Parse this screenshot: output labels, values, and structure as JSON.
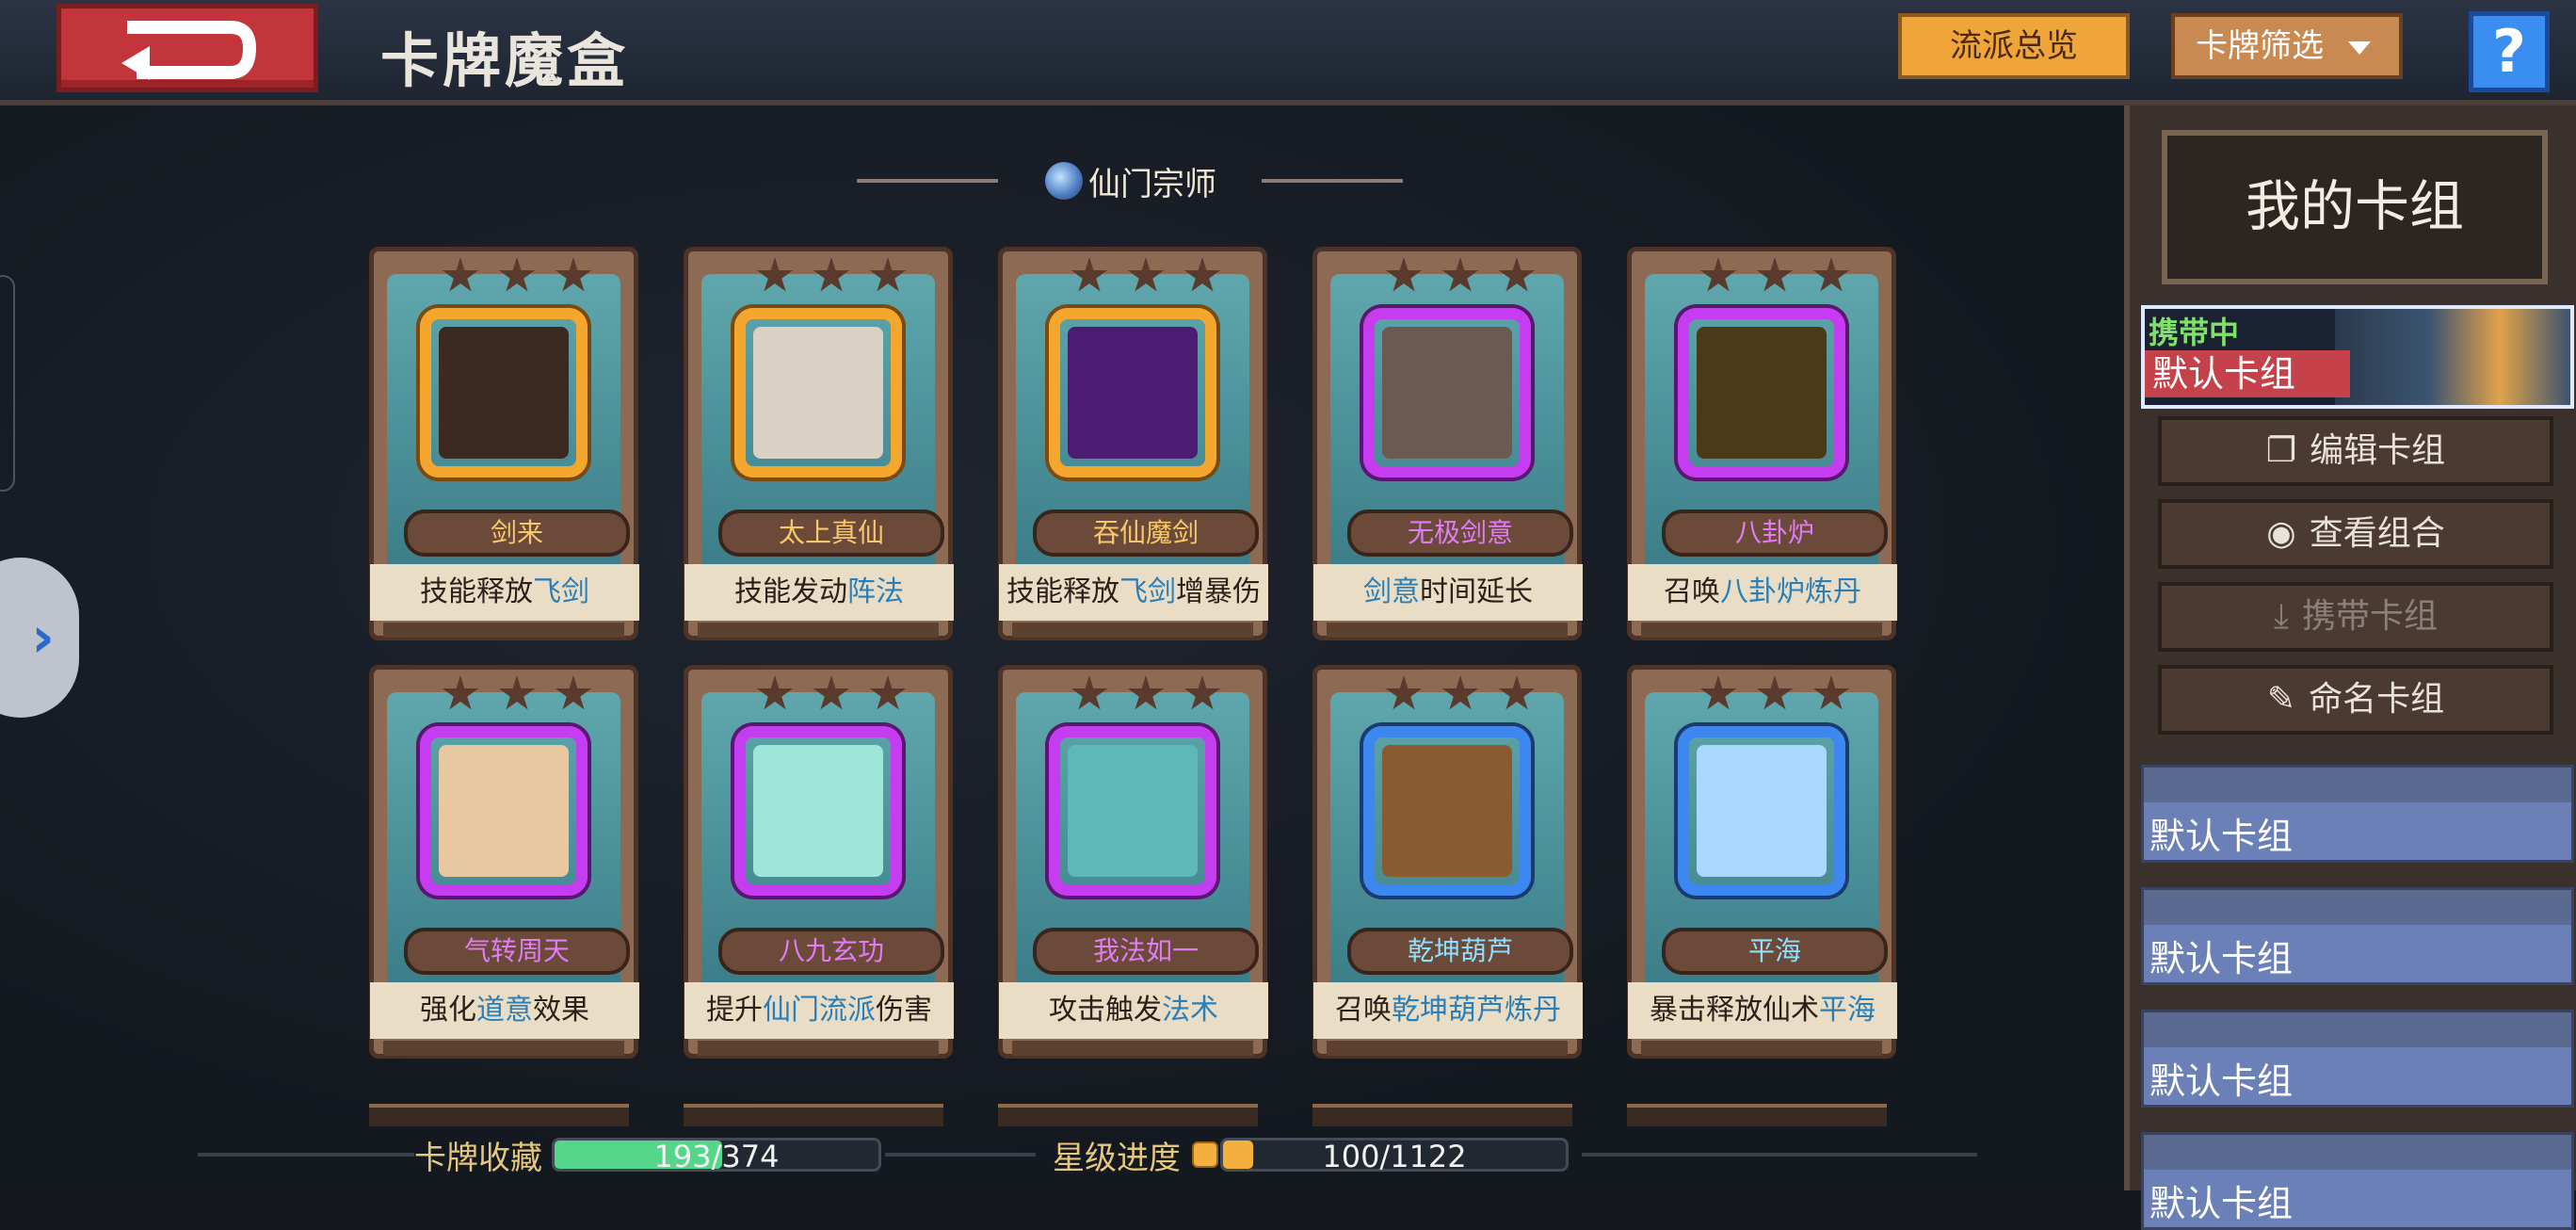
{
  "header": {
    "title": "卡牌魔盒",
    "overview_label": "流派总览",
    "filter_label": "卡牌筛选",
    "help_label": "?"
  },
  "section": {
    "title": "仙门宗师"
  },
  "cards": [
    {
      "name": "剑来",
      "desc_plain": "技能释放",
      "desc_hl": "飞剑",
      "desc_tail": "",
      "rarity": "gold",
      "art": "#3a2a20"
    },
    {
      "name": "太上真仙",
      "desc_plain": "技能发动",
      "desc_hl": "阵法",
      "desc_tail": "",
      "rarity": "gold",
      "art": "#d9d2c4"
    },
    {
      "name": "吞仙魔剑",
      "desc_plain": "技能释放",
      "desc_hl": "飞剑",
      "desc_tail": "增暴伤",
      "rarity": "gold",
      "art": "#4a1c72"
    },
    {
      "name": "无极剑意",
      "desc_plain": "",
      "desc_hl": "剑意",
      "desc_tail": "时间延长",
      "rarity": "purple",
      "art": "#6a5a50"
    },
    {
      "name": "八卦炉",
      "desc_plain": "召唤",
      "desc_hl": "八卦炉炼丹",
      "desc_tail": "",
      "rarity": "purple",
      "art": "#4a3a1a"
    },
    {
      "name": "气转周天",
      "desc_plain": "强化",
      "desc_hl": "道意",
      "desc_tail": "效果",
      "rarity": "purple",
      "art": "#e8c8a0"
    },
    {
      "name": "八九玄功",
      "desc_plain": "提升",
      "desc_hl": "仙门流派",
      "desc_tail": "伤害",
      "rarity": "purple",
      "art": "#9fe6d8"
    },
    {
      "name": "我法如一",
      "desc_plain": "攻击触发",
      "desc_hl": "法术",
      "desc_tail": "",
      "rarity": "purple",
      "art": "#5fb8b8"
    },
    {
      "name": "乾坤葫芦",
      "desc_plain": "召唤",
      "desc_hl": "乾坤葫芦炼丹",
      "desc_tail": "",
      "rarity": "blue",
      "art": "#8a5a30"
    },
    {
      "name": "平海",
      "desc_plain": "暴击释放仙术",
      "desc_hl": "平海",
      "desc_tail": "",
      "rarity": "blue",
      "art": "#a8d8ff"
    }
  ],
  "footer": {
    "collection_label": "卡牌收藏",
    "collection_value": "193/374",
    "collection_fraction": 0.516,
    "star_label": "星级进度",
    "star_value": "100/1122",
    "star_fraction": 0.089
  },
  "panel": {
    "title": "我的卡组",
    "active_deck": {
      "status": "携带中",
      "name": "默认卡组"
    },
    "actions": [
      {
        "label": "编辑卡组",
        "icon": "copy-icon",
        "glyph": "❐",
        "enabled": true
      },
      {
        "label": "查看组合",
        "icon": "eye-icon",
        "glyph": "◉",
        "enabled": true
      },
      {
        "label": "携带卡组",
        "icon": "download-icon",
        "glyph": "⤓",
        "enabled": false
      },
      {
        "label": "命名卡组",
        "icon": "pencil-icon",
        "glyph": "✎",
        "enabled": true
      }
    ],
    "decks": [
      "默认卡组",
      "默认卡组",
      "默认卡组",
      "默认卡组"
    ]
  }
}
